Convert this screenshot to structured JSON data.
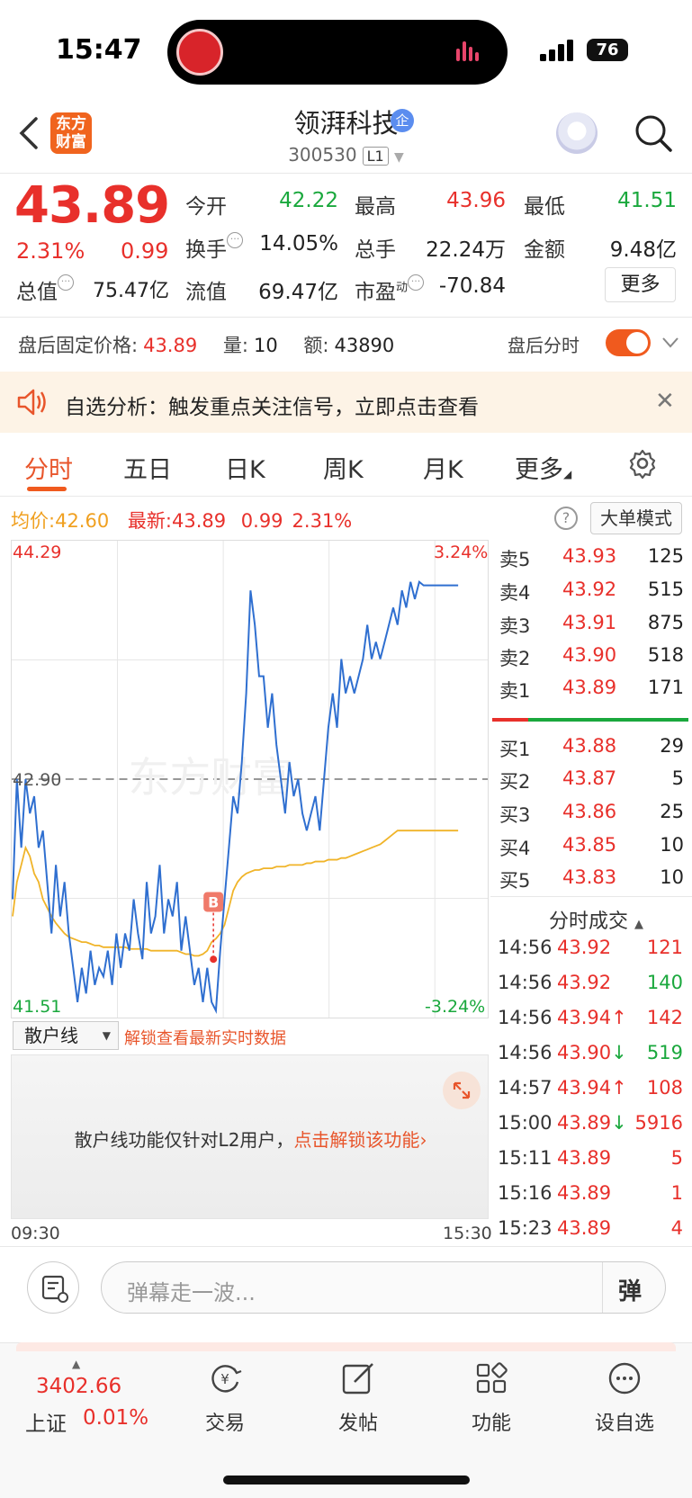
{
  "status": {
    "time": "15:47",
    "battery": "76"
  },
  "header": {
    "app_logo": "东方\n财富",
    "stock_name": "领湃科技",
    "badge": "企",
    "stock_code": "300530",
    "level": "L1"
  },
  "quote": {
    "price": "43.89",
    "change_pct": "2.31%",
    "change": "0.99",
    "open_label": "今开",
    "open": "42.22",
    "high_label": "最高",
    "high": "43.96",
    "low_label": "最低",
    "low": "41.51",
    "turnover_label": "换手",
    "turnover": "14.05%",
    "volume_label": "总手",
    "volume": "22.24万",
    "amount_label": "金额",
    "amount": "9.48亿",
    "mktcap_label": "总值",
    "mktcap": "75.47亿",
    "float_label": "流值",
    "float": "69.47亿",
    "pe_label": "市盈",
    "pe_sup": "动",
    "pe": "-70.84",
    "more": "更多"
  },
  "after_hours": {
    "price_label": "盘后固定价格:",
    "price": "43.89",
    "vol_label": "量:",
    "vol": "10",
    "amt_label": "额:",
    "amt": "43890",
    "toggle_label": "盘后分时"
  },
  "promo": {
    "text": "自选分析：触发重点关注信号，立即点击查看"
  },
  "tabs": [
    "分时",
    "五日",
    "日K",
    "周K",
    "月K",
    "更多"
  ],
  "info": {
    "avg_label": "均价:",
    "avg": "42.60",
    "last_label": "最新:",
    "last": "43.89",
    "chg": "0.99",
    "pct": "2.31%",
    "big_order": "大单模式"
  },
  "chart_data": {
    "type": "line",
    "yaxis_left": [
      "44.29",
      "42.90",
      "41.51"
    ],
    "yaxis_right": [
      "3.24%",
      "-3.24%"
    ],
    "ylim": [
      41.51,
      44.29
    ],
    "prev_close": 42.9,
    "x_start": "09:30",
    "x_end": "15:30",
    "marker": "B",
    "watermark": "东方财富",
    "series": [
      {
        "values": [
          42.2,
          42.9,
          42.5,
          42.9,
          42.7,
          42.8,
          42.5,
          42.6,
          42.3,
          42.0,
          42.4,
          42.1,
          42.3,
          42.0,
          41.8,
          41.6,
          41.8,
          41.65,
          41.9,
          41.7,
          41.8,
          41.75,
          41.9,
          41.7,
          42.0,
          41.8,
          42.0,
          41.9,
          42.2,
          42.0,
          41.85,
          42.3,
          42.0,
          42.1,
          42.4,
          42.0,
          42.2,
          42.1,
          42.3,
          41.9,
          42.1,
          41.9,
          41.7,
          41.8,
          41.6,
          41.8,
          41.6,
          41.55,
          41.9,
          42.2,
          42.5,
          42.8,
          42.7,
          43.0,
          43.4,
          44.0,
          43.8,
          43.5,
          43.5,
          43.2,
          43.4,
          43.1,
          42.9,
          42.7,
          43.0,
          42.8,
          42.9,
          42.7,
          42.6,
          42.7,
          42.8,
          42.6,
          42.9,
          43.2,
          43.4,
          43.2,
          43.6,
          43.4,
          43.5,
          43.4,
          43.5,
          43.6,
          43.8,
          43.6,
          43.7,
          43.6,
          43.7,
          43.8,
          43.9,
          43.8,
          44.0,
          43.9,
          44.05,
          43.95,
          44.05,
          44.03,
          44.03,
          44.03,
          44.03,
          44.03,
          44.03,
          44.03,
          44.03,
          44.03
        ]
      },
      {
        "values": [
          42.1,
          42.3,
          42.4,
          42.5,
          42.45,
          42.35,
          42.3,
          42.2,
          42.15,
          42.1,
          42.06,
          42.03,
          42.0,
          41.98,
          41.97,
          41.96,
          41.95,
          41.95,
          41.94,
          41.93,
          41.93,
          41.92,
          41.92,
          41.92,
          41.92,
          41.92,
          41.92,
          41.91,
          41.91,
          41.91,
          41.91,
          41.91,
          41.9,
          41.9,
          41.9,
          41.9,
          41.9,
          41.9,
          41.9,
          41.89,
          41.88,
          41.88,
          41.87,
          41.87,
          41.88,
          41.9,
          41.95,
          41.97,
          42.0,
          42.05,
          42.15,
          42.25,
          42.3,
          42.33,
          42.35,
          42.36,
          42.37,
          42.37,
          42.38,
          42.38,
          42.38,
          42.39,
          42.39,
          42.39,
          42.4,
          42.4,
          42.4,
          42.4,
          42.41,
          42.41,
          42.42,
          42.42,
          42.42,
          42.43,
          42.43,
          42.43,
          42.44,
          42.44,
          42.45,
          42.46,
          42.47,
          42.48,
          42.49,
          42.5,
          42.51,
          42.52,
          42.54,
          42.56,
          42.58,
          42.6,
          42.6,
          42.6,
          42.6,
          42.6,
          42.6,
          42.6,
          42.6,
          42.6,
          42.6,
          42.6,
          42.6,
          42.6,
          42.6,
          42.6
        ]
      }
    ]
  },
  "order_book": {
    "sell": [
      {
        "label": "卖5",
        "price": "43.93",
        "vol": "125"
      },
      {
        "label": "卖4",
        "price": "43.92",
        "vol": "515"
      },
      {
        "label": "卖3",
        "price": "43.91",
        "vol": "875"
      },
      {
        "label": "卖2",
        "price": "43.90",
        "vol": "518"
      },
      {
        "label": "卖1",
        "price": "43.89",
        "vol": "171"
      }
    ],
    "buy": [
      {
        "label": "买1",
        "price": "43.88",
        "vol": "29"
      },
      {
        "label": "买2",
        "price": "43.87",
        "vol": "5"
      },
      {
        "label": "买3",
        "price": "43.86",
        "vol": "25"
      },
      {
        "label": "买4",
        "price": "43.85",
        "vol": "10"
      },
      {
        "label": "买5",
        "price": "43.83",
        "vol": "10"
      }
    ]
  },
  "trades": {
    "title": "分时成交",
    "rows": [
      {
        "time": "14:56",
        "price": "43.92",
        "arrow": "",
        "vol": "121",
        "color": "#e8302b"
      },
      {
        "time": "14:56",
        "price": "43.92",
        "arrow": "",
        "vol": "140",
        "color": "#1aa83d"
      },
      {
        "time": "14:56",
        "price": "43.94",
        "arrow": "↑",
        "vol": "142",
        "color": "#e8302b"
      },
      {
        "time": "14:56",
        "price": "43.90",
        "arrow": "↓",
        "vol": "519",
        "color": "#1aa83d"
      },
      {
        "time": "14:57",
        "price": "43.94",
        "arrow": "↑",
        "vol": "108",
        "color": "#e8302b"
      },
      {
        "time": "15:00",
        "price": "43.89",
        "arrow": "↓",
        "vol": "5916",
        "color": "#e8302b"
      },
      {
        "time": "15:11",
        "price": "43.89",
        "arrow": "",
        "vol": "5",
        "color": "#e8302b"
      },
      {
        "time": "15:16",
        "price": "43.89",
        "arrow": "",
        "vol": "1",
        "color": "#e8302b"
      },
      {
        "time": "15:23",
        "price": "43.89",
        "arrow": "",
        "vol": "4",
        "color": "#e8302b"
      }
    ]
  },
  "retail": {
    "select": "散户线",
    "unlock_link": "解锁查看最新实时数据",
    "message": "散户线功能仅针对L2用户，",
    "message_link": "点击解锁该功能"
  },
  "comment": {
    "placeholder": "弹幕走一波...",
    "dan": "弹"
  },
  "bottom": {
    "index_value": "3402.66",
    "index_name": "上证",
    "index_pct": "0.01%",
    "nav": [
      {
        "label": "交易",
        "icon": "yen-exchange-icon"
      },
      {
        "label": "发帖",
        "icon": "edit-icon"
      },
      {
        "label": "功能",
        "icon": "grid-icon"
      },
      {
        "label": "设自选",
        "icon": "more-dots-icon"
      }
    ]
  },
  "colors": {
    "up": "#e8302b",
    "down": "#1aa83d",
    "accent": "#f05a1e",
    "price_line": "#2f6fd0",
    "avg_line": "#f0b429"
  }
}
